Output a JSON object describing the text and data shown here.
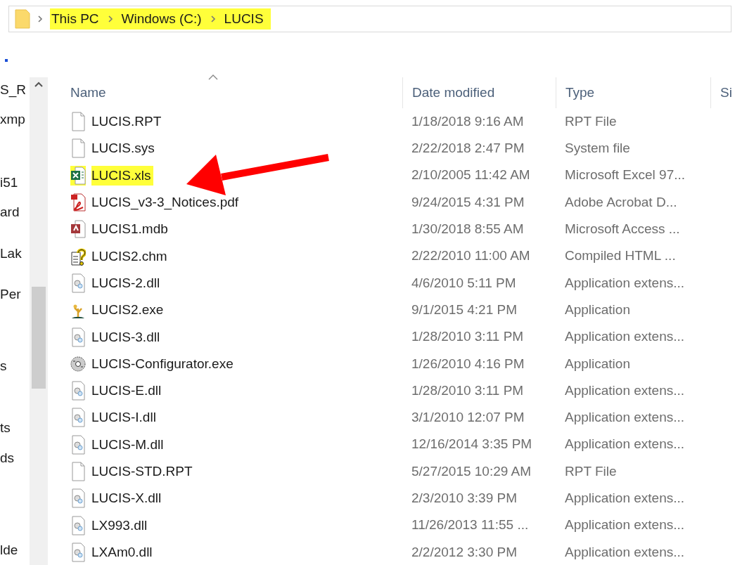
{
  "address_bar": {
    "highlighted": true,
    "crumbs": [
      "This PC",
      "Windows (C:)",
      "LUCIS"
    ]
  },
  "nav_pane": {
    "items": [
      "S_R",
      "xmp",
      "i51",
      "ard",
      "Lak",
      "Per",
      "s",
      "ts",
      "ds",
      "lde"
    ]
  },
  "columns": [
    "Name",
    "Date modified",
    "Type",
    "Si"
  ],
  "files": [
    {
      "name": "LUCIS.RPT",
      "date": "1/18/2018 9:16 AM",
      "type": "RPT File",
      "kind": "blank",
      "highlighted": false
    },
    {
      "name": "LUCIS.sys",
      "date": "2/22/2018 2:47 PM",
      "type": "System file",
      "kind": "blank",
      "highlighted": false
    },
    {
      "name": "LUCIS.xls",
      "date": "2/10/2005 11:42 AM",
      "type": "Microsoft Excel 97...",
      "kind": "excel",
      "highlighted": true
    },
    {
      "name": "LUCIS_v3-3_Notices.pdf",
      "date": "9/24/2015 4:31 PM",
      "type": "Adobe Acrobat D...",
      "kind": "pdf",
      "highlighted": false
    },
    {
      "name": "LUCIS1.mdb",
      "date": "1/30/2018 8:55 AM",
      "type": "Microsoft Access ...",
      "kind": "access",
      "highlighted": false
    },
    {
      "name": "LUCIS2.chm",
      "date": "2/22/2010 11:00 AM",
      "type": "Compiled HTML ...",
      "kind": "help",
      "highlighted": false
    },
    {
      "name": "LUCIS-2.dll",
      "date": "4/6/2010 5:11 PM",
      "type": "Application extens...",
      "kind": "dll",
      "highlighted": false
    },
    {
      "name": "LUCIS2.exe",
      "date": "9/1/2015 4:21 PM",
      "type": "Application",
      "kind": "app",
      "highlighted": false
    },
    {
      "name": "LUCIS-3.dll",
      "date": "1/28/2010 3:11 PM",
      "type": "Application extens...",
      "kind": "dll",
      "highlighted": false
    },
    {
      "name": "LUCIS-Configurator.exe",
      "date": "1/26/2010 4:16 PM",
      "type": "Application",
      "kind": "disc",
      "highlighted": false
    },
    {
      "name": "LUCIS-E.dll",
      "date": "1/28/2010 3:11 PM",
      "type": "Application extens...",
      "kind": "dll",
      "highlighted": false
    },
    {
      "name": "LUCIS-I.dll",
      "date": "3/1/2010 12:07 PM",
      "type": "Application extens...",
      "kind": "dll",
      "highlighted": false
    },
    {
      "name": "LUCIS-M.dll",
      "date": "12/16/2014 3:35 PM",
      "type": "Application extens...",
      "kind": "dll",
      "highlighted": false
    },
    {
      "name": "LUCIS-STD.RPT",
      "date": "5/27/2015 10:29 AM",
      "type": "RPT File",
      "kind": "blank",
      "highlighted": false
    },
    {
      "name": "LUCIS-X.dll",
      "date": "2/3/2010 3:39 PM",
      "type": "Application extens...",
      "kind": "dll",
      "highlighted": false
    },
    {
      "name": "LX993.dll",
      "date": "11/26/2013 11:55 ...",
      "type": "Application extens...",
      "kind": "dll",
      "highlighted": false
    },
    {
      "name": "LXAm0.dll",
      "date": "2/2/2012 3:30 PM",
      "type": "Application extens...",
      "kind": "dll",
      "highlighted": false
    }
  ]
}
